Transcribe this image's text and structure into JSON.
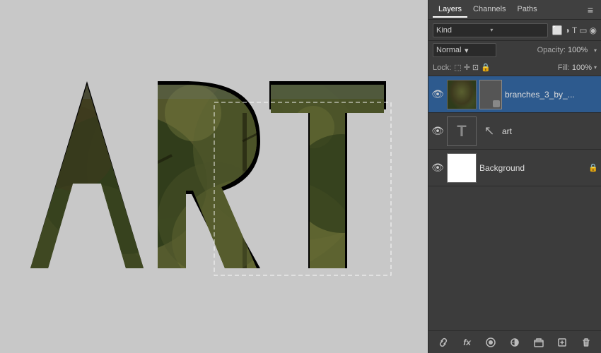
{
  "canvas": {
    "background": "#c8c8c8"
  },
  "panel": {
    "tabs": [
      {
        "label": "Layers",
        "active": true
      },
      {
        "label": "Channels",
        "active": false
      },
      {
        "label": "Paths",
        "active": false
      }
    ],
    "kind_label": "Kind",
    "blend_mode": "Normal",
    "opacity_label": "Opacity:",
    "opacity_value": "100%",
    "lock_label": "Lock:",
    "fill_label": "Fill:",
    "fill_value": "100%",
    "layers": [
      {
        "name": "branches_3_by_...",
        "type": "image",
        "visible": true,
        "selected": true,
        "has_mask": true
      },
      {
        "name": "art",
        "type": "text",
        "visible": true,
        "selected": false,
        "has_mask": false
      },
      {
        "name": "Background",
        "type": "normal",
        "visible": true,
        "selected": false,
        "locked": true,
        "has_mask": false
      }
    ],
    "toolbar_buttons": [
      "link-icon",
      "fx-icon",
      "mask-icon",
      "adjustment-icon",
      "folder-icon",
      "trash-icon"
    ]
  }
}
